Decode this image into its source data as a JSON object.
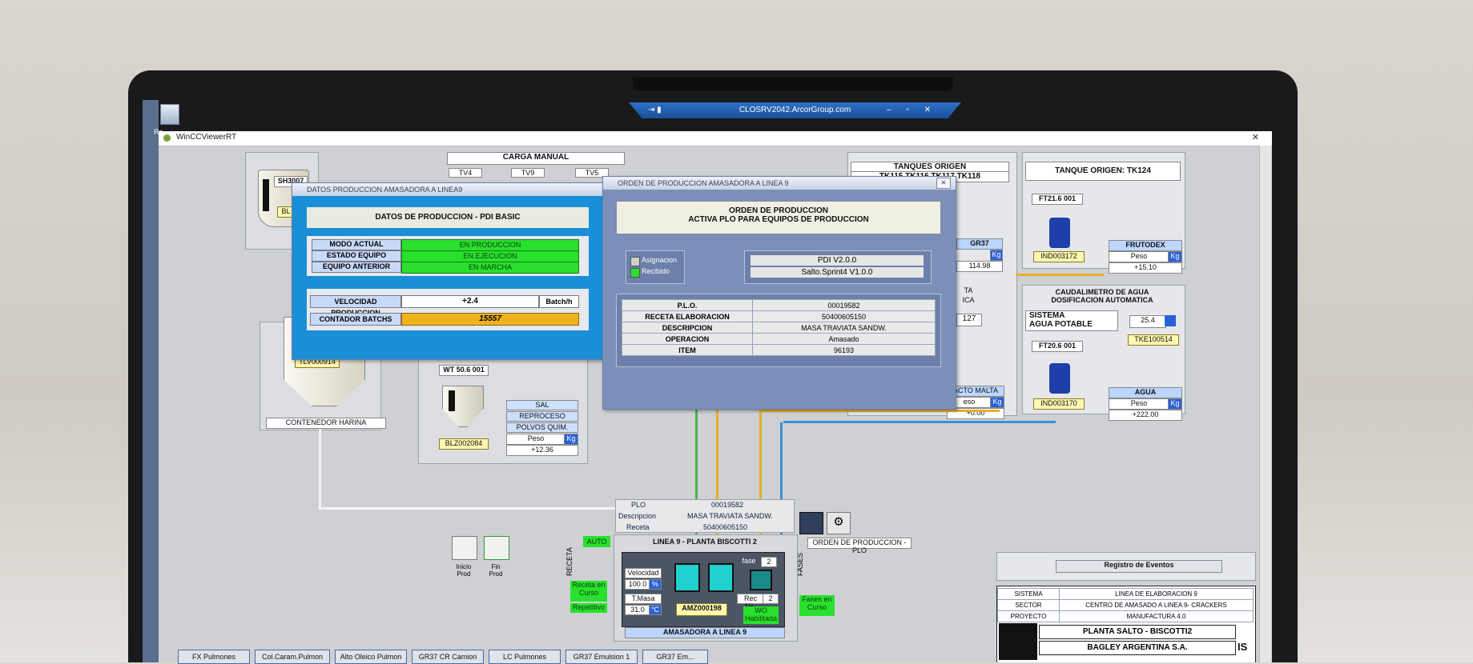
{
  "rdp": {
    "title": "CLOSRV2042.ArcorGroup.com",
    "controls": "– ▫ ✕"
  },
  "window": {
    "title": "WinCCViewerRT",
    "close": "✕"
  },
  "desktop": {
    "recycle_label": "Re"
  },
  "scada": {
    "carga_manual": "CARGA MANUAL",
    "silo_top": "SH3007",
    "silo_tag": "BL",
    "tv_labels": [
      "TV4",
      "TV9",
      "TV5"
    ],
    "tanques_origen_left": "TANQUES ORIGEN",
    "tanques_origen_left_sub": "TK115 TK116 TK117 TK118",
    "tanques_origen_right": "TANQUE ORIGEN: TK124",
    "ft_right_top": "FT21.6 001",
    "ind_right_top": "IND003172",
    "frutodex": {
      "title": "FRUTODEX",
      "peso": "Peso",
      "unit": "Kg",
      "value": "+15.10"
    },
    "gr37": {
      "title": "GR37",
      "unit": "Kg",
      "value": "114.98"
    },
    "caudalimetro": "CAUDALIMETRO DE AGUA\nDOSIFICACION AUTOMATICA",
    "sistema_agua": "SISTEMA\nAGUA POTABLE",
    "agua_value": "25.4",
    "tke": "TKE100514",
    "ft_right_bottom": "FT20.6 001",
    "ind_right_bottom": "IND003170",
    "agua": {
      "title": "AGUA",
      "peso": "Peso",
      "unit": "Kg",
      "value": "+222.00"
    },
    "malta": {
      "title": "ACTO MALTA",
      "peso": "eso",
      "unit": "Kg",
      "value": "+0.00"
    },
    "ta_frag": "TA",
    "ica_frag": "ICA",
    "n127": "127",
    "tlv": "TLV000914",
    "contenedor": "CONTENEDOR HARINA",
    "wt": "WT 50.6 001",
    "blz": "BLZ002084",
    "sal_list": [
      "SAL",
      "REPROCESO",
      "POLVOS QUIM."
    ],
    "sal_peso": "Peso",
    "sal_unit": "Kg",
    "sal_value": "+12.36",
    "plo_label": "PLO",
    "plo_value": "00019582",
    "desc_label": "Descripcion",
    "desc_value": "MASA TRAVIATA SANDW.",
    "receta_label": "Receta",
    "receta_value": "50400605150",
    "orden_plo_label": "ORDEN DE PRODUCCION - PLO",
    "auto": "AUTO",
    "receta_vertical": "RECETA",
    "fases_vertical": "FASES",
    "receta_curso": "Receta en\nCurso",
    "repetitivo": "Repetitivo",
    "fases_curso": "Fases en\nCurso",
    "inicio": "Inicio\nProd",
    "fin": "Fin\nProd",
    "linea_title": "LINEA 9 - PLANTA BISCOTTI 2",
    "velocidad": "Velocidad",
    "velocidad_value": "100.0",
    "velocidad_unit": "%",
    "tmasa": "T.Masa",
    "tmasa_value": "31.0",
    "tmasa_unit": "°C",
    "amz": "AMZ000198",
    "fase": "fase",
    "fase_value": "2",
    "rec_no": "Rec No.",
    "rec_no_value": "2",
    "wo": "WO\nHabilitada",
    "amasadora": "AMASADORA A LINEA 9",
    "registro": "Registro de Eventos",
    "info": [
      {
        "k": "SISTEMA",
        "v": "LINEA DE ELABORACION 9"
      },
      {
        "k": "SECTOR",
        "v": "CENTRO DE AMASADO A LINEA 9- CRACKERS"
      },
      {
        "k": "PROYECTO",
        "v": "MANUFACTURA 4.0"
      }
    ],
    "planta": "PLANTA SALTO - BISCOTTI2",
    "bagley": "BAGLEY ARGENTINA S.A.",
    "is": "IS",
    "bottom_tabs": [
      "FX Pulmones",
      "Col.Caram.Pulmon",
      "Alto Oleico Pulmon",
      "GR37 CR Camion",
      "LC Pulmones",
      "GR37 Emulsion 1",
      "GR37 Em..."
    ]
  },
  "datos_dialog": {
    "title": "DATOS  PRODUCCION AMASADORA A LINEA9",
    "header": "DATOS DE PRODUCCION - PDI BASIC",
    "rows": [
      {
        "label": "MODO ACTUAL",
        "value": "EN PRODUCCION"
      },
      {
        "label": "ESTADO EQUIPO",
        "value": "EN EJECUCION"
      },
      {
        "label": "EQUIPO ANTERIOR",
        "value": "EN MARCHA"
      }
    ],
    "velocidad_label": "VELOCIDAD PRODUCCION",
    "velocidad_value": "+2.4",
    "velocidad_unit": "Batch/h",
    "contador_label": "CONTADOR BATCHS",
    "contador_value": "15557"
  },
  "orden_dialog": {
    "title": "ORDEN DE PRODUCCION AMASADORA A LINEA 9",
    "close": "✕",
    "header_line1": "ORDEN DE PRODUCCION",
    "header_line2": "ACTIVA PLO PARA EQUIPOS DE PRODUCCION",
    "asignacion": "Asignacion",
    "recibido": "Recibido",
    "pdi_version": "PDI V2.0.0",
    "salto_version": "Salto.Sprint4 V1.0.0",
    "rows": [
      {
        "label": "P.L.O.",
        "value": "00019582"
      },
      {
        "label": "RECETA ELABORACION",
        "value": "50400605150"
      },
      {
        "label": "DESCRIPCION",
        "value": "MASA TRAVIATA SANDW."
      },
      {
        "label": "OPERACION",
        "value": "Amasado"
      },
      {
        "label": "ITEM",
        "value": "96193"
      }
    ]
  }
}
